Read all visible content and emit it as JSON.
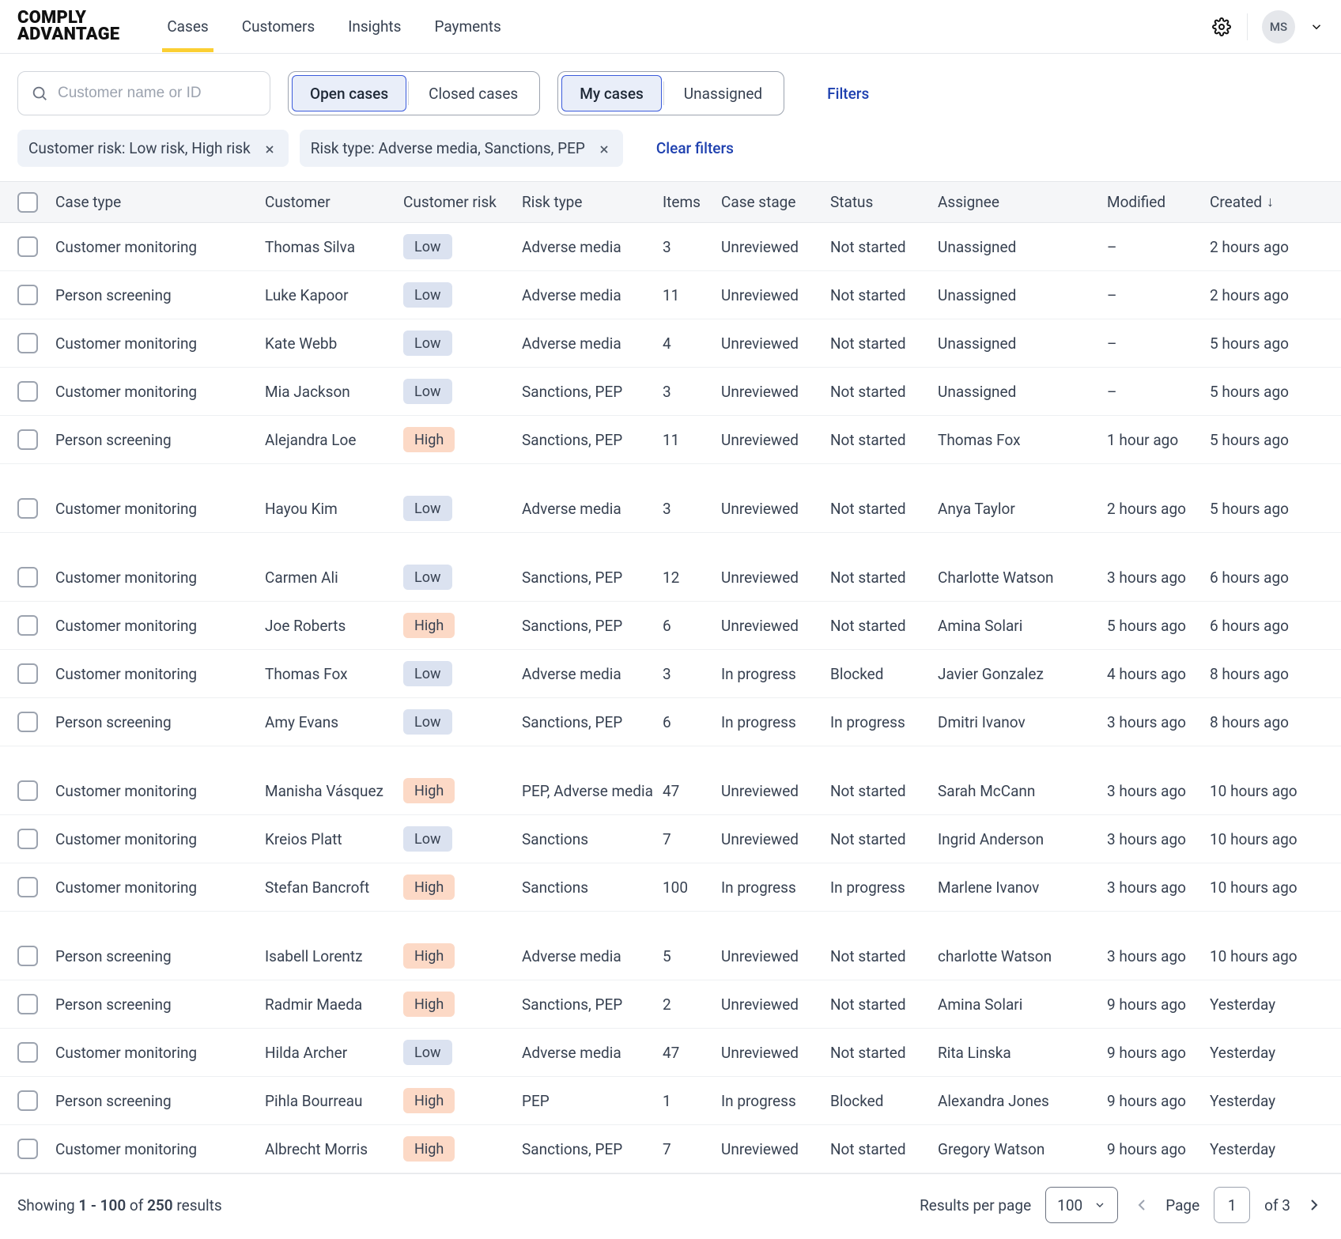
{
  "brand": {
    "line1": "COMPLY",
    "line2": "ADVANTAGE"
  },
  "nav": {
    "items": [
      "Cases",
      "Customers",
      "Insights",
      "Payments"
    ],
    "active_index": 0
  },
  "user": {
    "initials": "MS"
  },
  "search": {
    "placeholder": "Customer name or ID"
  },
  "segments": {
    "group1": [
      {
        "label": "Open cases",
        "selected": true
      },
      {
        "label": "Closed cases",
        "selected": false
      }
    ],
    "group2": [
      {
        "label": "My cases",
        "selected": true
      },
      {
        "label": "Unassigned",
        "selected": false
      }
    ]
  },
  "filters_link": "Filters",
  "chips": [
    {
      "label": "Customer risk: Low risk, High risk"
    },
    {
      "label": "Risk type: Adverse media, Sanctions, PEP"
    }
  ],
  "clear_filters": "Clear filters",
  "columns": {
    "case_type": "Case type",
    "customer": "Customer",
    "customer_risk": "Customer risk",
    "risk_type": "Risk type",
    "items": "Items",
    "case_stage": "Case stage",
    "status": "Status",
    "assignee": "Assignee",
    "modified": "Modified",
    "created": "Created"
  },
  "sort": {
    "column": "created",
    "dir": "desc"
  },
  "groups": [
    [
      {
        "case_type": "Customer monitoring",
        "customer": "Thomas Silva",
        "risk": "Low",
        "risk_type": "Adverse media",
        "items": "3",
        "stage": "Unreviewed",
        "status": "Not started",
        "assignee": "Unassigned",
        "modified": "–",
        "created": "2 hours ago"
      },
      {
        "case_type": "Person screening",
        "customer": "Luke Kapoor",
        "risk": "Low",
        "risk_type": "Adverse media",
        "items": "11",
        "stage": "Unreviewed",
        "status": "Not started",
        "assignee": "Unassigned",
        "modified": "–",
        "created": "2 hours ago"
      },
      {
        "case_type": "Customer monitoring",
        "customer": "Kate Webb",
        "risk": "Low",
        "risk_type": "Adverse media",
        "items": "4",
        "stage": "Unreviewed",
        "status": "Not started",
        "assignee": "Unassigned",
        "modified": "–",
        "created": "5 hours ago"
      },
      {
        "case_type": "Customer monitoring",
        "customer": "Mia Jackson",
        "risk": "Low",
        "risk_type": "Sanctions, PEP",
        "items": "3",
        "stage": "Unreviewed",
        "status": "Not started",
        "assignee": "Unassigned",
        "modified": "–",
        "created": "5 hours ago"
      },
      {
        "case_type": "Person screening",
        "customer": "Alejandra Loe",
        "risk": "High",
        "risk_type": "Sanctions, PEP",
        "items": "11",
        "stage": "Unreviewed",
        "status": "Not started",
        "assignee": "Thomas Fox",
        "modified": "1 hour ago",
        "created": "5 hours ago"
      }
    ],
    [
      {
        "case_type": "Customer monitoring",
        "customer": "Hayou Kim",
        "risk": "Low",
        "risk_type": "Adverse media",
        "items": "3",
        "stage": "Unreviewed",
        "status": "Not started",
        "assignee": "Anya Taylor",
        "modified": "2 hours ago",
        "created": "5 hours ago"
      }
    ],
    [
      {
        "case_type": "Customer monitoring",
        "customer": "Carmen Ali",
        "risk": "Low",
        "risk_type": "Sanctions, PEP",
        "items": "12",
        "stage": "Unreviewed",
        "status": "Not started",
        "assignee": "Charlotte Watson",
        "modified": "3 hours ago",
        "created": "6 hours ago"
      },
      {
        "case_type": "Customer monitoring",
        "customer": "Joe Roberts",
        "risk": "High",
        "risk_type": "Sanctions, PEP",
        "items": "6",
        "stage": "Unreviewed",
        "status": "Not started",
        "assignee": "Amina Solari",
        "modified": "5 hours ago",
        "created": "6 hours ago"
      },
      {
        "case_type": "Customer monitoring",
        "customer": "Thomas Fox",
        "risk": "Low",
        "risk_type": "Adverse media",
        "items": "3",
        "stage": "In progress",
        "status": "Blocked",
        "assignee": "Javier Gonzalez",
        "modified": "4 hours ago",
        "created": "8 hours ago"
      },
      {
        "case_type": "Person screening",
        "customer": "Amy Evans",
        "risk": "Low",
        "risk_type": "Sanctions, PEP",
        "items": "6",
        "stage": "In progress",
        "status": "In progress",
        "assignee": "Dmitri Ivanov",
        "modified": "3 hours ago",
        "created": "8 hours ago"
      }
    ],
    [
      {
        "case_type": "Customer monitoring",
        "customer": "Manisha Vásquez",
        "risk": "High",
        "risk_type": "PEP, Adverse media",
        "items": "47",
        "stage": "Unreviewed",
        "status": "Not started",
        "assignee": "Sarah McCann",
        "modified": "3 hours ago",
        "created": "10 hours ago"
      },
      {
        "case_type": "Customer monitoring",
        "customer": "Kreios Platt",
        "risk": "Low",
        "risk_type": "Sanctions",
        "items": "7",
        "stage": "Unreviewed",
        "status": "Not started",
        "assignee": "Ingrid Anderson",
        "modified": "3 hours ago",
        "created": "10 hours ago"
      },
      {
        "case_type": "Customer monitoring",
        "customer": "Stefan Bancroft",
        "risk": "High",
        "risk_type": "Sanctions",
        "items": "100",
        "stage": "In progress",
        "status": "In progress",
        "assignee": "Marlene Ivanov",
        "modified": "3 hours ago",
        "created": "10 hours ago"
      }
    ],
    [
      {
        "case_type": "Person screening",
        "customer": "Isabell Lorentz",
        "risk": "High",
        "risk_type": "Adverse media",
        "items": "5",
        "stage": "Unreviewed",
        "status": "Not started",
        "assignee": "charlotte Watson",
        "modified": "3 hours ago",
        "created": "10 hours ago"
      },
      {
        "case_type": "Person screening",
        "customer": "Radmir Maeda",
        "risk": "High",
        "risk_type": "Sanctions, PEP",
        "items": "2",
        "stage": "Unreviewed",
        "status": "Not started",
        "assignee": "Amina Solari",
        "modified": "9 hours ago",
        "created": "Yesterday"
      },
      {
        "case_type": "Customer monitoring",
        "customer": "Hilda Archer",
        "risk": "Low",
        "risk_type": "Adverse media",
        "items": "47",
        "stage": "Unreviewed",
        "status": "Not started",
        "assignee": "Rita Linska",
        "modified": "9 hours ago",
        "created": "Yesterday"
      },
      {
        "case_type": "Person screening",
        "customer": "Pihla Bourreau",
        "risk": "High",
        "risk_type": "PEP",
        "items": "1",
        "stage": "In progress",
        "status": "Blocked",
        "assignee": "Alexandra Jones",
        "modified": "9 hours ago",
        "created": "Yesterday"
      },
      {
        "case_type": "Customer monitoring",
        "customer": "Albrecht Morris",
        "risk": "High",
        "risk_type": "Sanctions, PEP",
        "items": "7",
        "stage": "Unreviewed",
        "status": "Not started",
        "assignee": "Gregory Watson",
        "modified": "9 hours ago",
        "created": "Yesterday"
      }
    ]
  ],
  "footer": {
    "showing_prefix": "Showing ",
    "range": "1 - 100",
    "of_word": " of ",
    "total": "250",
    "results_word": " results",
    "rpp_label": "Results per page",
    "rpp_value": "100",
    "page_label": "Page",
    "page_value": "1",
    "page_of": "of 3"
  }
}
